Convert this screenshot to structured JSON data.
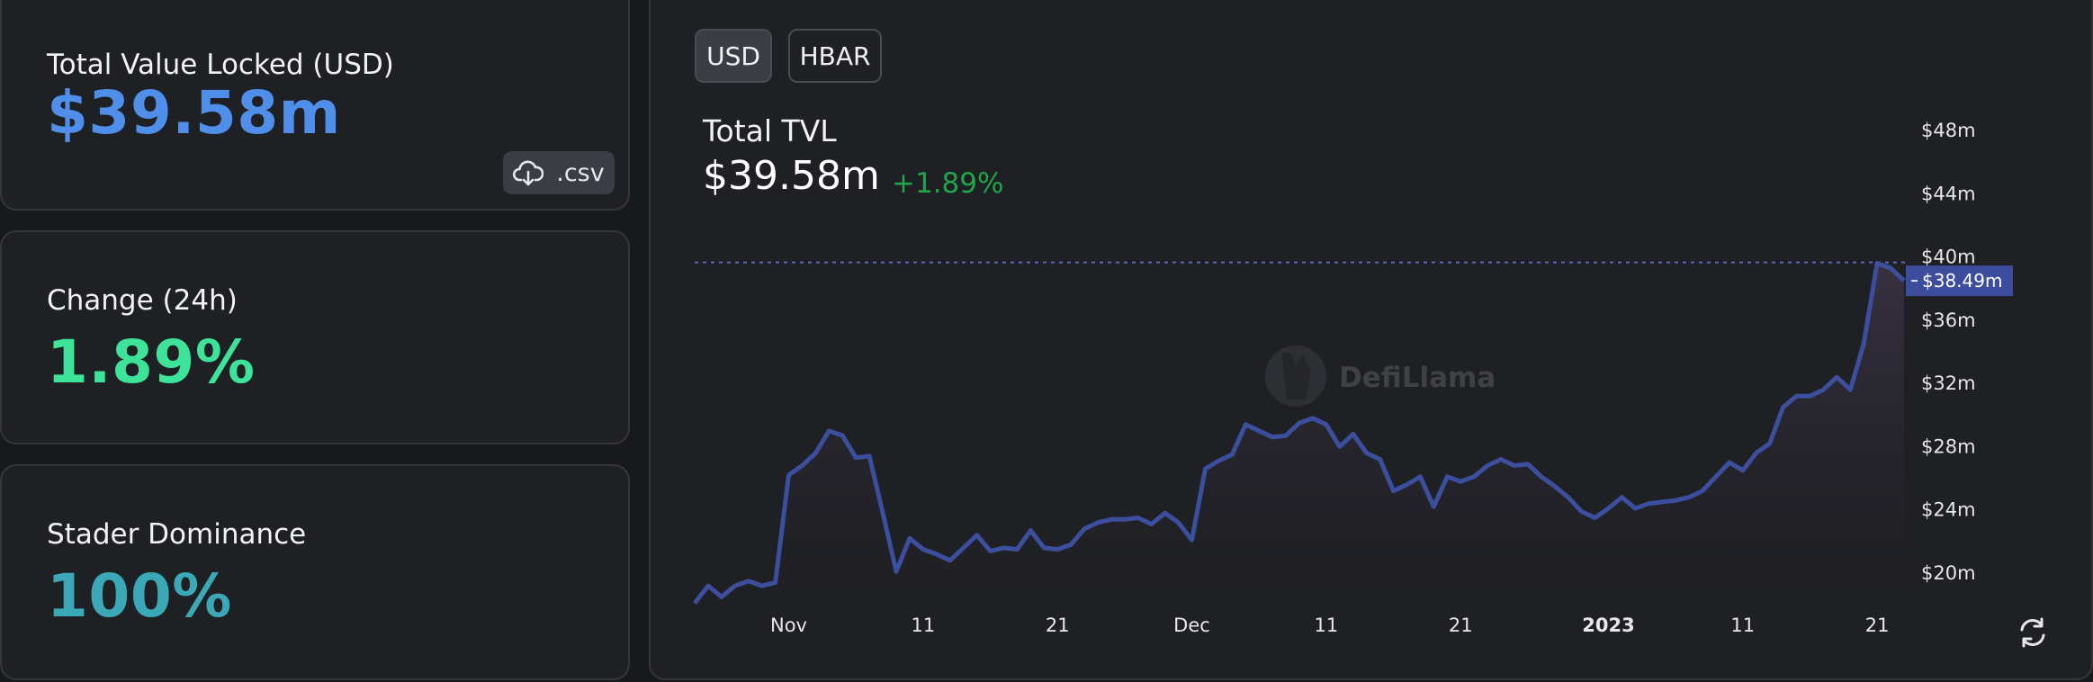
{
  "stats": {
    "tvl": {
      "label": "Total Value Locked (USD)",
      "value": "$39.58m"
    },
    "change": {
      "label": "Change (24h)",
      "value": "1.89%"
    },
    "dominance": {
      "label": "Stader Dominance",
      "value": "100%"
    },
    "csv_label": ".csv"
  },
  "toggles": {
    "usd": "USD",
    "hbar": "HBAR",
    "selected": "USD"
  },
  "chart_header": {
    "title": "Total TVL",
    "value": "$39.58m",
    "change": "+1.89%"
  },
  "watermark": "DefiLlama",
  "icons": {
    "download": "cloud-download-icon",
    "refresh": "refresh-icon",
    "logo": "llama-logo-icon"
  },
  "colors": {
    "line": "#3c4f9e",
    "tvl": "#4f8ee9",
    "change": "#3ee39a",
    "dominance": "#3ba8b8",
    "positive": "#1fa54a",
    "marker": "#3b4d9c"
  },
  "chart_data": {
    "type": "area",
    "title": "Total TVL",
    "ylim": [
      18,
      49
    ],
    "y_ticks": [
      {
        "v": 48,
        "label": "$48m"
      },
      {
        "v": 44,
        "label": "$44m"
      },
      {
        "v": 40,
        "label": "$40m"
      },
      {
        "v": 36,
        "label": "$36m"
      },
      {
        "v": 32,
        "label": "$32m"
      },
      {
        "v": 28,
        "label": "$28m"
      },
      {
        "v": 24,
        "label": "$24m"
      },
      {
        "v": 20,
        "label": "$20m"
      }
    ],
    "x_ticks": [
      {
        "i": 7,
        "label": "Nov",
        "bold": false
      },
      {
        "i": 17,
        "label": "11",
        "bold": false
      },
      {
        "i": 27,
        "label": "21",
        "bold": false
      },
      {
        "i": 37,
        "label": "Dec",
        "bold": false
      },
      {
        "i": 47,
        "label": "11",
        "bold": false
      },
      {
        "i": 57,
        "label": "21",
        "bold": false
      },
      {
        "i": 68,
        "label": "2023",
        "bold": true
      },
      {
        "i": 78,
        "label": "11",
        "bold": false
      },
      {
        "i": 88,
        "label": "21",
        "bold": false
      }
    ],
    "grid": false,
    "crosshair": {
      "value": 38.49,
      "label": "$38.49m"
    },
    "series": [
      {
        "values": [
          18.1,
          19.2,
          18.5,
          19.2,
          19.5,
          19.2,
          19.4,
          26.2,
          26.8,
          27.6,
          29.0,
          28.7,
          27.3,
          27.4,
          23.8,
          20.1,
          22.2,
          21.5,
          21.2,
          20.8,
          21.6,
          22.4,
          21.4,
          21.6,
          21.5,
          22.7,
          21.6,
          21.5,
          21.8,
          22.8,
          23.2,
          23.4,
          23.4,
          23.5,
          23.1,
          23.8,
          23.2,
          22.1,
          26.6,
          27.1,
          27.5,
          29.4,
          29.0,
          28.6,
          28.7,
          29.5,
          29.8,
          29.4,
          28.0,
          28.8,
          27.6,
          27.2,
          25.2,
          25.6,
          26.1,
          24.2,
          26.1,
          25.8,
          26.1,
          26.8,
          27.2,
          26.8,
          26.9,
          26.1,
          25.5,
          24.8,
          23.9,
          23.5,
          24.1,
          24.8,
          24.1,
          24.4,
          24.5,
          24.6,
          24.8,
          25.2,
          26.1,
          27.0,
          26.5,
          27.6,
          28.2,
          30.5,
          31.2,
          31.2,
          31.6,
          32.4,
          31.6,
          34.5,
          39.6,
          39.3,
          38.5
        ]
      }
    ]
  }
}
